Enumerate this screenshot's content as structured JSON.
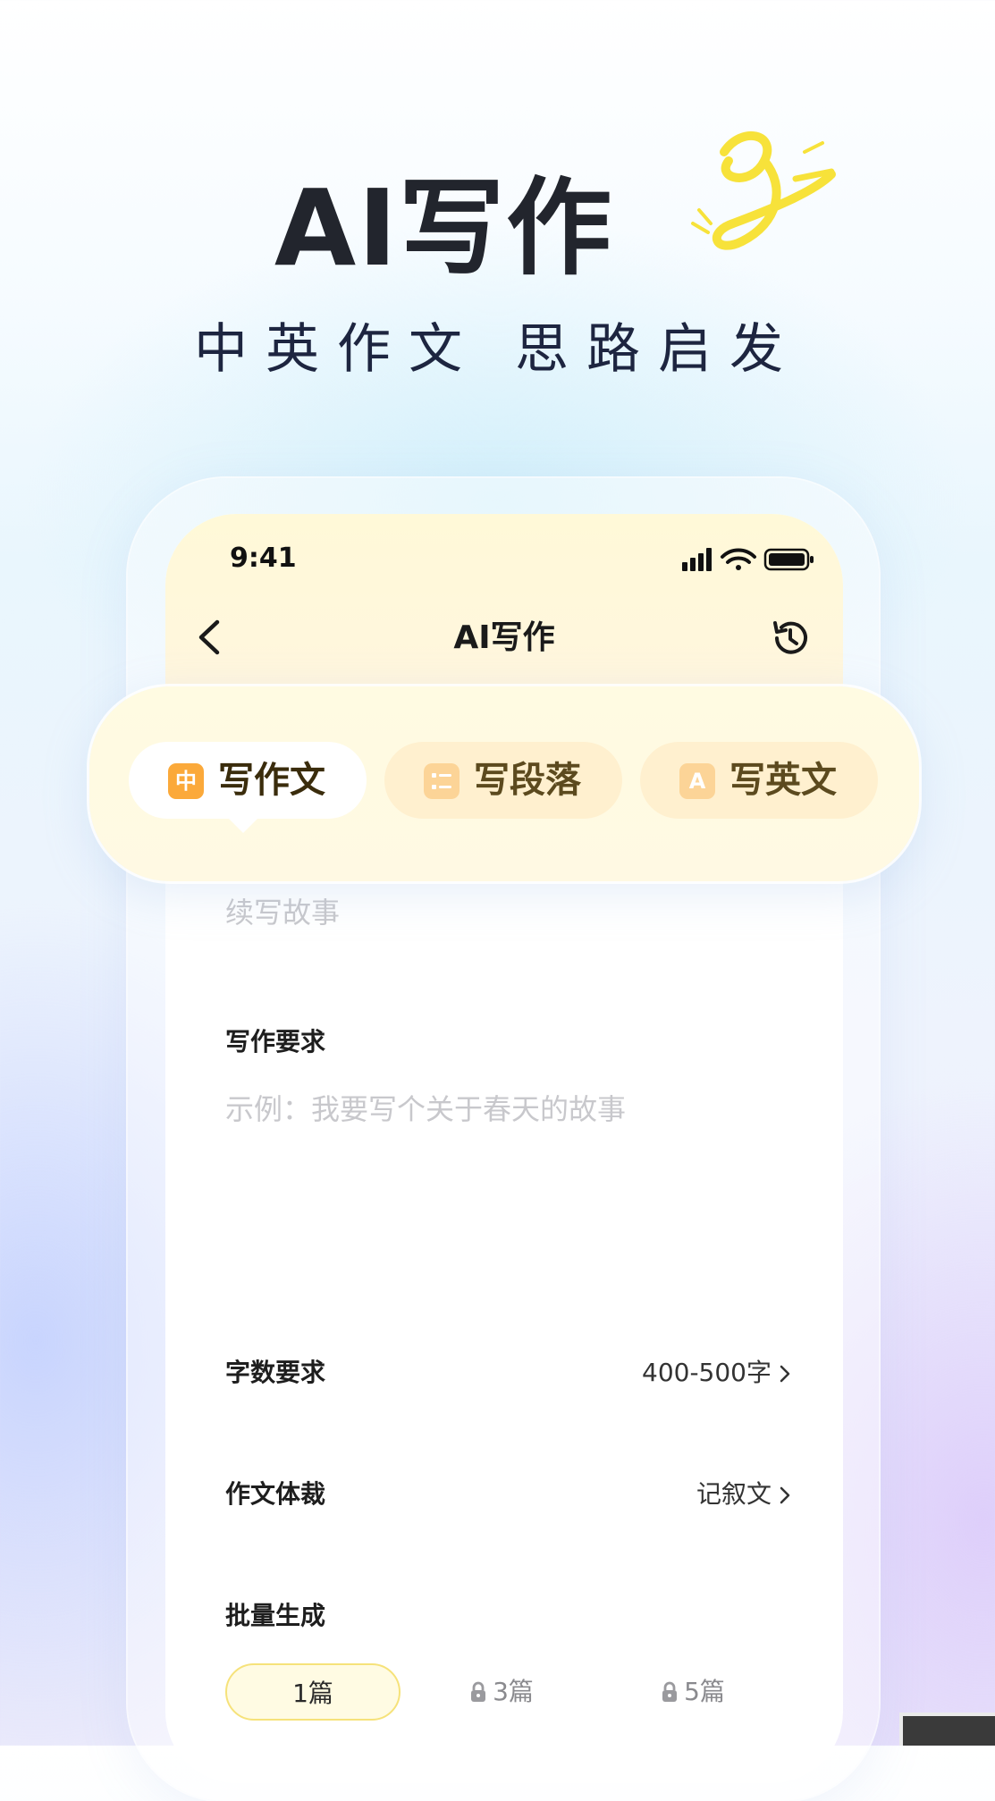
{
  "hero": {
    "title": "AI写作",
    "subtitle": "中英作文 思路启发",
    "accent_color": "#f7e23a"
  },
  "phone": {
    "status_bar": {
      "time": "9:41",
      "icons": [
        "signal-icon",
        "wifi-icon",
        "battery-icon"
      ]
    },
    "nav": {
      "title": "AI写作",
      "back_icon": "chevron-left-icon",
      "history_icon": "history-icon"
    },
    "tabs": [
      {
        "label": "写作文",
        "icon": "zh-icon",
        "icon_glyph": "中",
        "active": true
      },
      {
        "label": "写段落",
        "icon": "list-icon",
        "active": false
      },
      {
        "label": "写英文",
        "icon": "letter-a-icon",
        "icon_glyph": "A",
        "active": false
      }
    ],
    "form": {
      "topic_placeholder": "续写故事",
      "requirement": {
        "label": "写作要求",
        "placeholder": "示例：我要写个关于春天的故事"
      },
      "word_count": {
        "label": "字数要求",
        "value": "400-500字"
      },
      "genre": {
        "label": "作文体裁",
        "value": "记叙文"
      },
      "batch": {
        "label": "批量生成",
        "options": [
          {
            "label": "1篇",
            "locked": false,
            "selected": true
          },
          {
            "label": "3篇",
            "locked": true,
            "selected": false
          },
          {
            "label": "5篇",
            "locked": true,
            "selected": false
          }
        ]
      }
    }
  },
  "colors": {
    "tab_active_bg": "#ffffff",
    "tab_inactive_bg": "#fff0cf",
    "tab_icon_orange": "#fba93a",
    "placeholder_gray": "#c8c8cc",
    "selected_option_border": "#f6e27a"
  }
}
